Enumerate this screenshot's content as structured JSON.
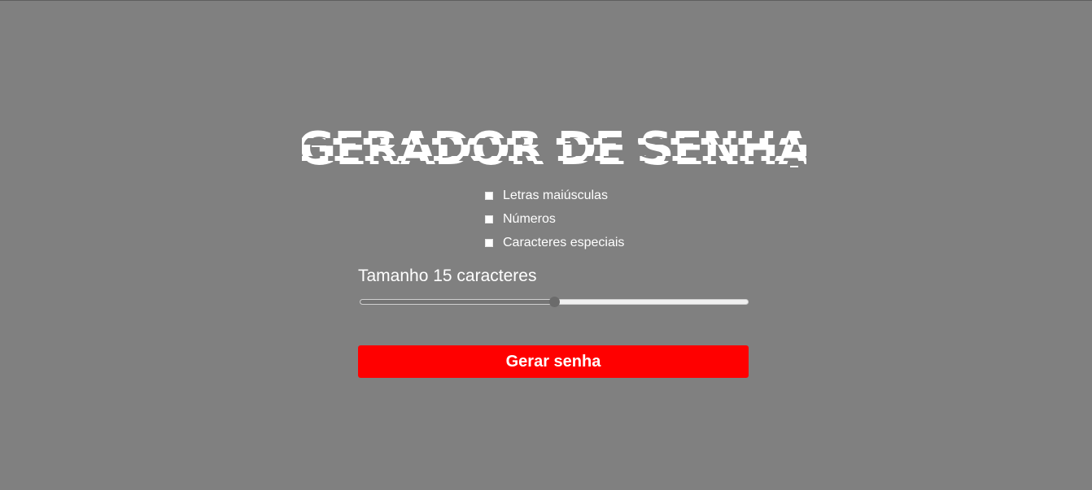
{
  "page": {
    "title": "GERADOR DE SENHA",
    "background_color": "#808080"
  },
  "options": [
    {
      "label": "Letras maiúsculas",
      "checked": false
    },
    {
      "label": "Números",
      "checked": false
    },
    {
      "label": "Caracteres especiais",
      "checked": false
    }
  ],
  "length": {
    "label": "Tamanho 15 caracteres",
    "value": 15,
    "fraction": 0.5
  },
  "generate_button": {
    "label": "Gerar senha",
    "color": "#ff0000"
  }
}
